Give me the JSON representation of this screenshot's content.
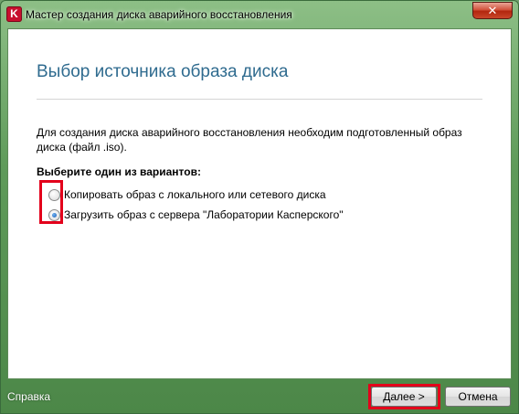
{
  "window": {
    "title": "Мастер создания диска аварийного восстановления",
    "logo_letter": "K",
    "close_label": "✕"
  },
  "page": {
    "title": "Выбор источника образа диска",
    "description": "Для создания диска аварийного восстановления необходим подготовленный образ диска (файл .iso).",
    "prompt": "Выберите один из вариантов:",
    "options": [
      {
        "label": "Копировать образ с локального или сетевого диска",
        "selected": false
      },
      {
        "label": "Загрузить образ с сервера \"Лаборатории Касперского\"",
        "selected": true
      }
    ]
  },
  "footer": {
    "help_label": "Справка",
    "next_label": "Далее >",
    "cancel_label": "Отмена"
  },
  "colors": {
    "title_text": "#2f6b8f",
    "highlight": "#e3001b",
    "frame": "#5f9b5a"
  }
}
